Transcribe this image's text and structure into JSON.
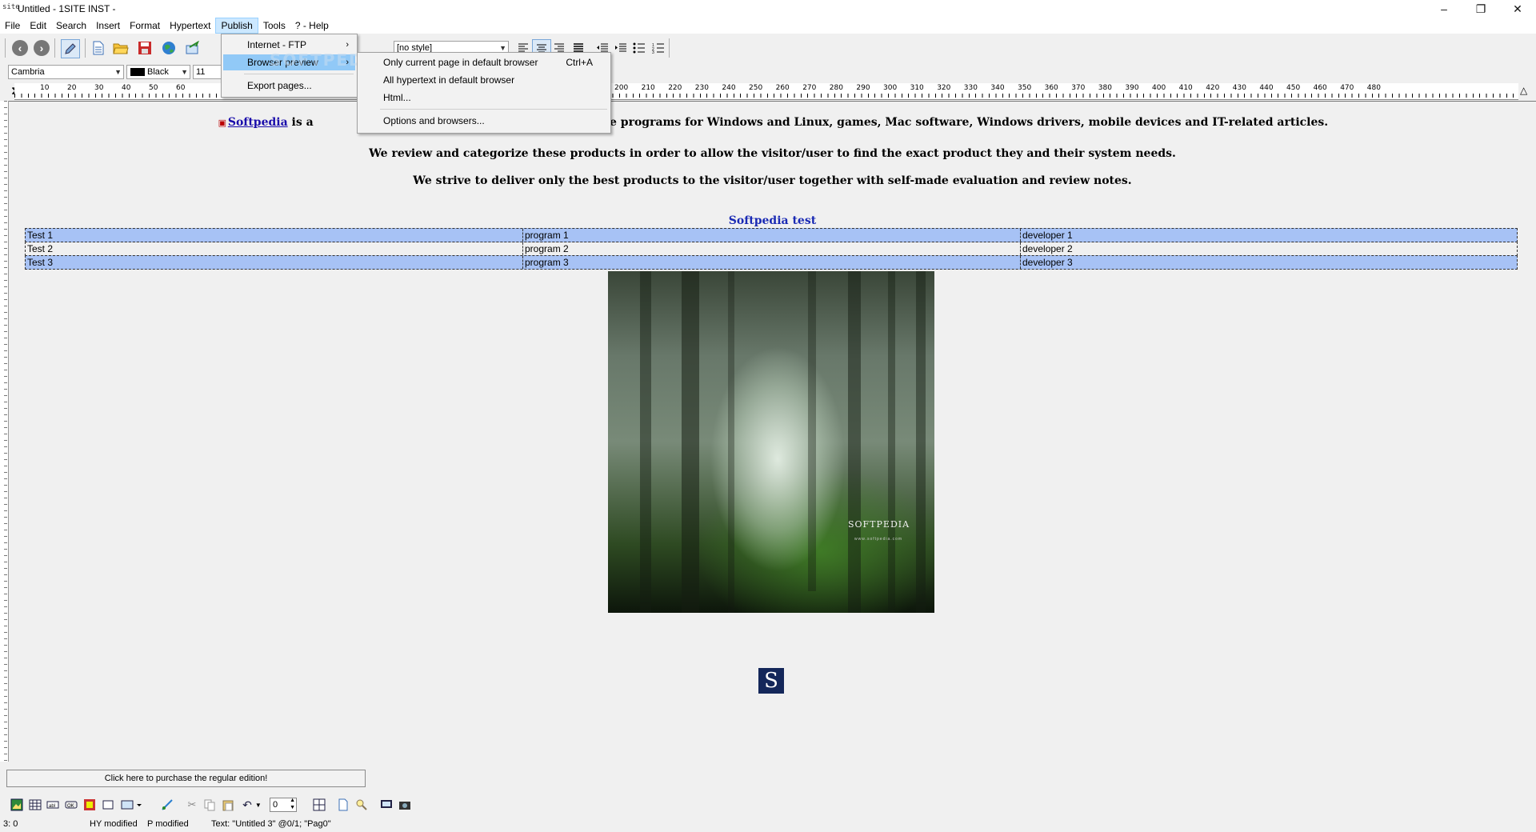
{
  "window": {
    "app_icon": "site",
    "title": "Untitled - 1SITE INST -",
    "controls": {
      "minimize": "–",
      "maximize": "❐",
      "close": "✕"
    }
  },
  "menubar": [
    {
      "label": "File"
    },
    {
      "label": "Edit"
    },
    {
      "label": "Search"
    },
    {
      "label": "Insert"
    },
    {
      "label": "Format"
    },
    {
      "label": "Hypertext"
    },
    {
      "label": "Publish",
      "active": true
    },
    {
      "label": "Tools"
    },
    {
      "label": "? - Help"
    }
  ],
  "toolbar": {
    "style_select": "[no style]",
    "font_select": "Cambria",
    "color_select": "Black",
    "size_select": "11",
    "icons": [
      "back-icon",
      "forward-icon",
      "edit-icon",
      "new-page-icon",
      "open-folder-icon",
      "save-icon",
      "globe-icon",
      "publish-icon"
    ],
    "align_icons": [
      "align-left-icon",
      "align-center-icon",
      "align-right-icon",
      "justify-icon",
      "outdent-icon",
      "indent-icon",
      "bullet-list-icon",
      "numbered-list-icon"
    ]
  },
  "ruler": {
    "labels": [
      "10",
      "20",
      "30",
      "40",
      "50",
      "60",
      "200",
      "210",
      "220",
      "230",
      "240",
      "250",
      "260",
      "270",
      "280",
      "290",
      "300",
      "310",
      "320",
      "330",
      "340",
      "350",
      "360",
      "370",
      "380",
      "390",
      "400",
      "410",
      "420",
      "430",
      "440",
      "450",
      "460",
      "470",
      "480"
    ]
  },
  "document": {
    "para1_link": "Softpedia",
    "para1_start": " is a",
    "para1_rest": "oftware programs for Windows and Linux, games, Mac software, Windows drivers, mobile devices and IT-related articles.",
    "para2": "We review and categorize these products in order to allow the visitor/user to find the exact product they and their system needs.",
    "para3": "We strive to deliver only the best products to the visitor/user together with self-made evaluation and review notes.",
    "table_title": "Softpedia test",
    "table_rows": [
      [
        "Test 1",
        "program 1",
        "developer 1"
      ],
      [
        "Test 2",
        "program 2",
        "developer 2"
      ],
      [
        "Test 3",
        "program 3",
        "developer 3"
      ]
    ],
    "image_brand": "SOFTPEDIA",
    "image_subtitle": "www.softpedia.com",
    "logo_letter": "S"
  },
  "publish_menu": {
    "items": [
      {
        "label": "Internet - FTP",
        "submenu": true
      },
      {
        "label": "Browser preview",
        "submenu": true,
        "highlighted": true
      },
      {
        "label": "Export pages..."
      }
    ]
  },
  "browser_preview_menu": {
    "items": [
      {
        "label": "Only current page in default browser",
        "shortcut": "Ctrl+A"
      },
      {
        "label": "All hypertext in default browser"
      },
      {
        "label": "Html..."
      },
      {
        "label": "Options and browsers..."
      }
    ]
  },
  "watermark": "SOFTPEDIA",
  "bottom": {
    "purchase_button": "Click here to purchase the regular edition!",
    "spin_value": "0"
  },
  "status": {
    "position": "3: 0",
    "hy": "HY modified",
    "p": "P modified",
    "text": "Text: \"Untitled 3\" @0/1; \"Pag0\""
  }
}
